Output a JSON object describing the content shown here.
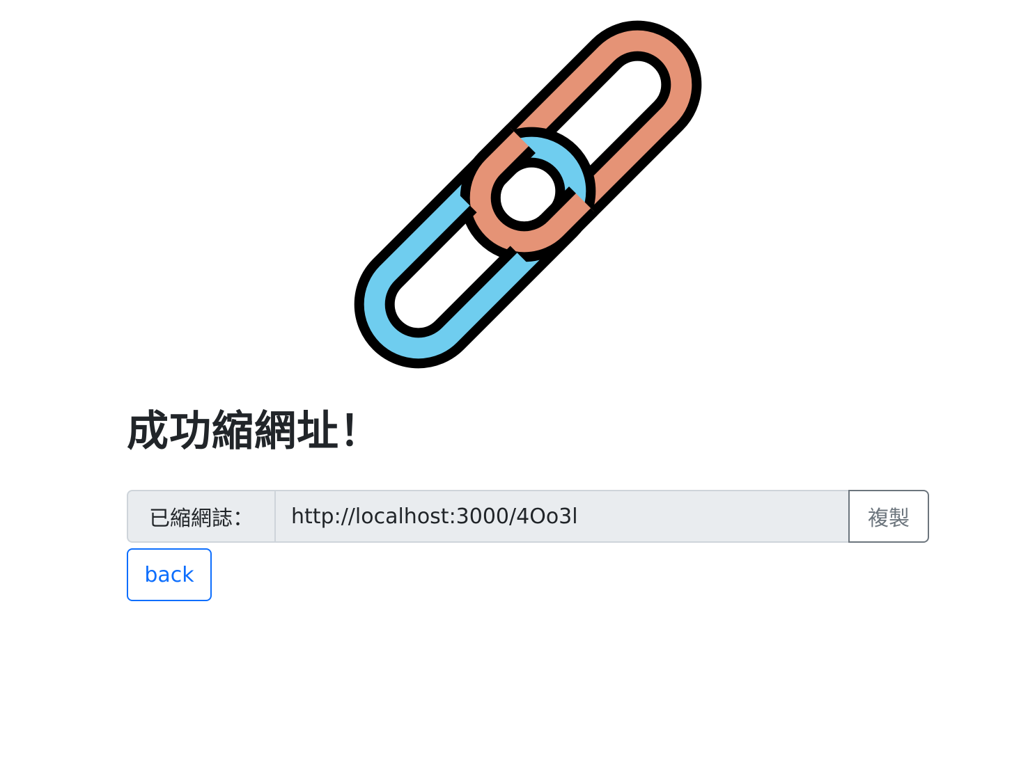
{
  "logo": {
    "icon": "chain-link-icon",
    "colors": {
      "left_link": "#6fcdef",
      "right_link": "#e59376",
      "outline": "#000000"
    }
  },
  "page": {
    "title": "成功縮網址！"
  },
  "url_group": {
    "prefix_label": "已縮網誌：",
    "short_url": "http://localhost:3000/4Oo3l",
    "copy_label": "複製"
  },
  "back": {
    "label": "back"
  },
  "colors": {
    "primary": "#0d6efd",
    "secondary": "#6c757d",
    "field_bg": "#e9ecef",
    "text": "#212529"
  }
}
